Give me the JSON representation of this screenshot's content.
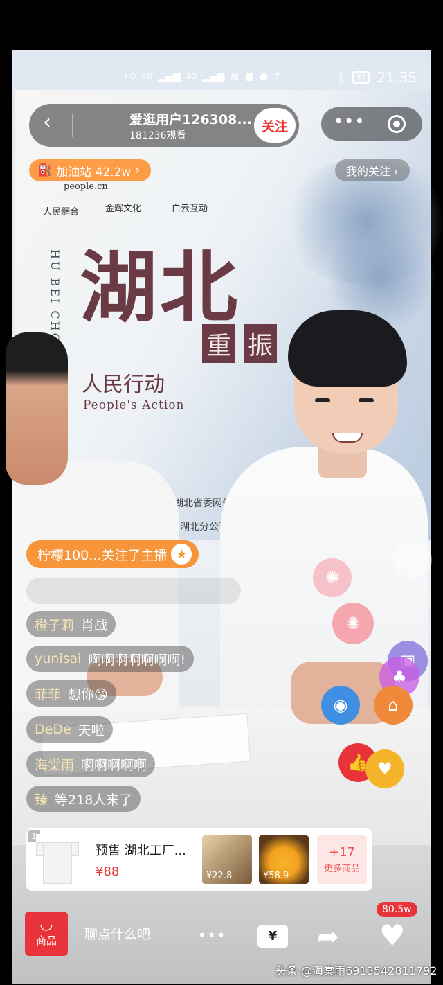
{
  "status_bar": {
    "network_labels": [
      "HD",
      "HD",
      "4G",
      "4G"
    ],
    "battery": "37",
    "time": "21:35"
  },
  "header": {
    "host_name": "爱逛用户126308...",
    "viewers": "181236观看",
    "follow_label": "关注",
    "gas_station": "加油站 42.2w",
    "gas_chevron": "›",
    "my_follow": "我的关注 ›"
  },
  "poster": {
    "sponsor_1": "people.cn",
    "sponsor_2": "人民網合",
    "sponsor_3": "金辉文化",
    "sponsor_4": "白云互动",
    "vertical_text": "HU BEI CHONG ZHEN",
    "title": "湖北",
    "sub_1": "重",
    "sub_2": "振",
    "action_cn": "人民行动",
    "action_en": "People's Action",
    "org_row_1": "人民网　湖北省委网信办　人",
    "org_row_2": "民网湖北分公司　人民"
  },
  "notification": {
    "text": "柠檬100...关注了主播",
    "icon": "star-icon"
  },
  "comments": [
    {
      "user": "橙子莉",
      "text": "肖战"
    },
    {
      "user": "yunisai",
      "text": "啊啊啊啊啊啊啊!"
    },
    {
      "user": "菲菲",
      "text": "想你😘"
    },
    {
      "user": "DeDe",
      "text": "天啦"
    },
    {
      "user": "海棠雨",
      "text": "啊啊啊啊啊"
    },
    {
      "user": "臻",
      "text": "等218人来了"
    }
  ],
  "product": {
    "index": "1",
    "title": "预售 湖北工厂...",
    "price": "¥88",
    "thumb_1_price": "¥22.8",
    "thumb_2_price": "¥58.9",
    "more_count": "+17",
    "more_label": "更多商品"
  },
  "bottom_bar": {
    "shop_label": "商品",
    "chat_placeholder": "聊点什么吧",
    "more_dots": "•••",
    "gift_label": "¥",
    "likes_count": "80.5w"
  },
  "watermark": "头条 @海棠雨6913542811792",
  "colors": {
    "accent_red": "#e9333a",
    "orange": "#f58c28",
    "comment_user": "#f7e5b4"
  }
}
